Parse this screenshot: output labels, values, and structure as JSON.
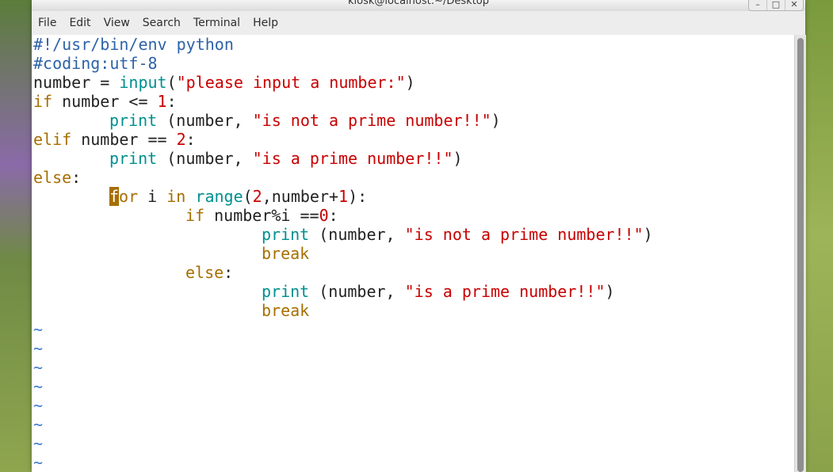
{
  "window": {
    "title": "kiosk@localhost:~/Desktop"
  },
  "menubar": {
    "items": [
      "File",
      "Edit",
      "View",
      "Search",
      "Terminal",
      "Help"
    ]
  },
  "editor": {
    "l1": "#!/usr/bin/env python",
    "l2": "#coding:utf-8",
    "l3": {
      "var": "number = ",
      "func": "input",
      "open": "(",
      "str": "\"please input a number:\"",
      "close": ")"
    },
    "l4": {
      "kw": "if",
      "mid": " number <= ",
      "num": "1",
      "end": ":"
    },
    "l5": {
      "func": "print",
      "mid": " (number, ",
      "str": "\"is not a prime number!!\"",
      "end": ")"
    },
    "l6": {
      "kw": "elif",
      "mid": " number == ",
      "num": "2",
      "end": ":"
    },
    "l7": {
      "func": "print",
      "mid": " (number, ",
      "str": "\"is a prime number!!\"",
      "end": ")"
    },
    "l8": {
      "kw": "else",
      "end": ":"
    },
    "l9": {
      "cursor": "f",
      "kw_rest": "or",
      "mid1": " i ",
      "kw_in": "in",
      "sp": " ",
      "func": "range",
      "open": "(",
      "num": "2",
      "mid2": ",number+",
      "num2": "1",
      "end": "):"
    },
    "l10": {
      "kw": "if",
      "mid": " number%i ==",
      "num": "0",
      "end": ":"
    },
    "l11": {
      "func": "print",
      "mid": " (number, ",
      "str": "\"is not a prime number!!\"",
      "end": ")"
    },
    "l12": {
      "kw": "break"
    },
    "l13": {
      "kw": "else",
      "end": ":"
    },
    "l14": {
      "func": "print",
      "mid": " (number, ",
      "str": "\"is a prime number!!\"",
      "end": ")"
    },
    "l15": {
      "kw": "break"
    },
    "tilde": "~"
  },
  "colors": {
    "comment": "#2d63a8",
    "function": "#008f8f",
    "keyword": "#a66e00",
    "string": "#c80000",
    "tilde": "#3b7bd0"
  }
}
